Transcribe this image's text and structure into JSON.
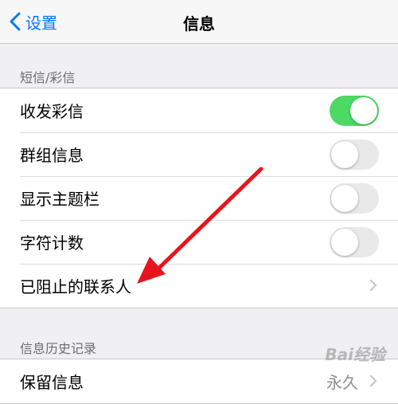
{
  "navbar": {
    "back_label": "设置",
    "title": "信息"
  },
  "sections": [
    {
      "header": "短信/彩信",
      "rows": [
        {
          "label": "收发彩信",
          "toggle": true
        },
        {
          "label": "群组信息",
          "toggle": false
        },
        {
          "label": "显示主题栏",
          "toggle": false
        },
        {
          "label": "字符计数",
          "toggle": false
        },
        {
          "label": "已阻止的联系人",
          "disclosure": true
        }
      ]
    },
    {
      "header": "信息历史记录",
      "rows": [
        {
          "label": "保留信息",
          "value": "永久",
          "disclosure": true
        }
      ]
    }
  ],
  "colors": {
    "accent": "#007aff",
    "toggle_on": "#4cd964",
    "annotation_arrow": "#e8141c"
  },
  "watermark": "Bai经验"
}
